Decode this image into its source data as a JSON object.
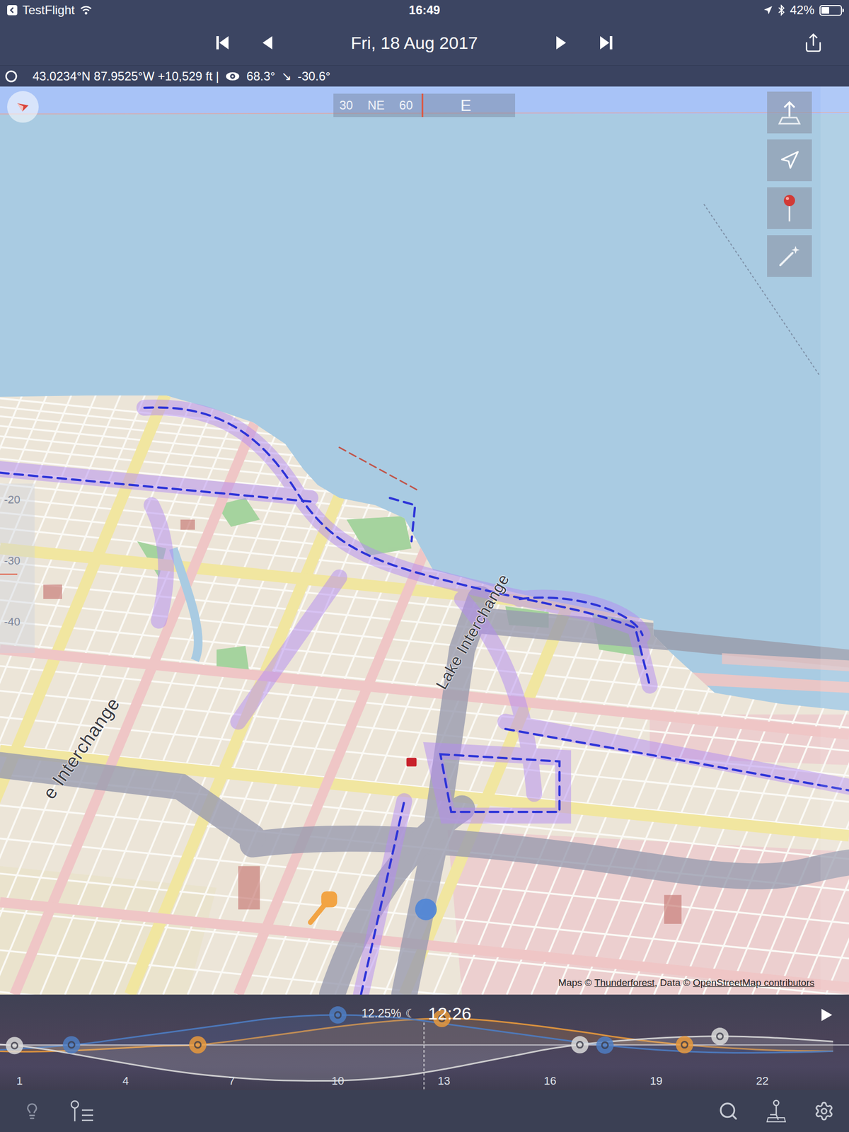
{
  "status_bar": {
    "carrier": "TestFlight",
    "time": "16:49",
    "battery": "42%",
    "battery_level": 0.42
  },
  "nav": {
    "date": "Fri, 18 Aug 2017"
  },
  "info": {
    "position": "43.0234°N 87.9525°W +10,529 ft |",
    "azimuth": "68.3°",
    "direction": "↘",
    "elevation": "-30.6°"
  },
  "compass": {
    "ticks": [
      "30",
      "NE",
      "60"
    ],
    "heading": "E"
  },
  "elevation_scale": [
    "-20",
    "-30",
    "-40"
  ],
  "map": {
    "labels": [
      "Lake Interchange",
      "e Interchange"
    ],
    "pins": [
      {
        "kind": "sun",
        "color": "#f2a444"
      },
      {
        "kind": "moon",
        "color": "#4f86d6"
      },
      {
        "kind": "target",
        "color": "#c8202a"
      }
    ],
    "attribution": [
      {
        "text": "Maps © ",
        "link": false
      },
      {
        "text": "Thunderforest",
        "link": true
      },
      {
        "text": ", Data © ",
        "link": false
      },
      {
        "text": "OpenStreetMap contributors",
        "link": true
      }
    ]
  },
  "timeline": {
    "hours": [
      "1",
      "4",
      "7",
      "10",
      "13",
      "16",
      "19",
      "22"
    ],
    "moon_phase": "12.25%",
    "moon_icon": "☾",
    "time": "12:26",
    "playing": false,
    "series": [
      {
        "name": "sun",
        "color": "#e8993c",
        "values": [
          -12,
          -14,
          -13,
          -10,
          -6,
          -2,
          0,
          8,
          18,
          28,
          38,
          46,
          52,
          55,
          52,
          45,
          36,
          26,
          15,
          6,
          -1,
          -6,
          -10,
          -12,
          -13
        ]
      },
      {
        "name": "moon",
        "color": "#4d7cc2",
        "values": [
          -12,
          -8,
          -3,
          4,
          14,
          24,
          34,
          44,
          54,
          60,
          62,
          60,
          54,
          44,
          34,
          24,
          14,
          4,
          -4,
          -10,
          -14,
          -16,
          -16,
          -15,
          -13
        ]
      },
      {
        "name": "milky_way",
        "color": "#d9d9d9",
        "values": [
          3,
          -2,
          -12,
          -25,
          -38,
          -50,
          -60,
          -67,
          -72,
          -74,
          -74,
          -70,
          -62,
          -50,
          -36,
          -22,
          -8,
          2,
          9,
          14,
          17,
          18,
          16,
          12,
          7
        ]
      }
    ],
    "markers": [
      {
        "series": "milky_way",
        "hour": 0.86
      },
      {
        "series": "moon",
        "hour": 2.47
      },
      {
        "series": "sun",
        "hour": 6.04
      },
      {
        "series": "moon",
        "hour": 10
      },
      {
        "series": "sun",
        "hour": 12.94
      },
      {
        "series": "milky_way",
        "hour": 16.84
      },
      {
        "series": "moon",
        "hour": 17.55
      },
      {
        "series": "sun",
        "hour": 19.8
      },
      {
        "series": "milky_way",
        "hour": 20.8
      }
    ]
  }
}
